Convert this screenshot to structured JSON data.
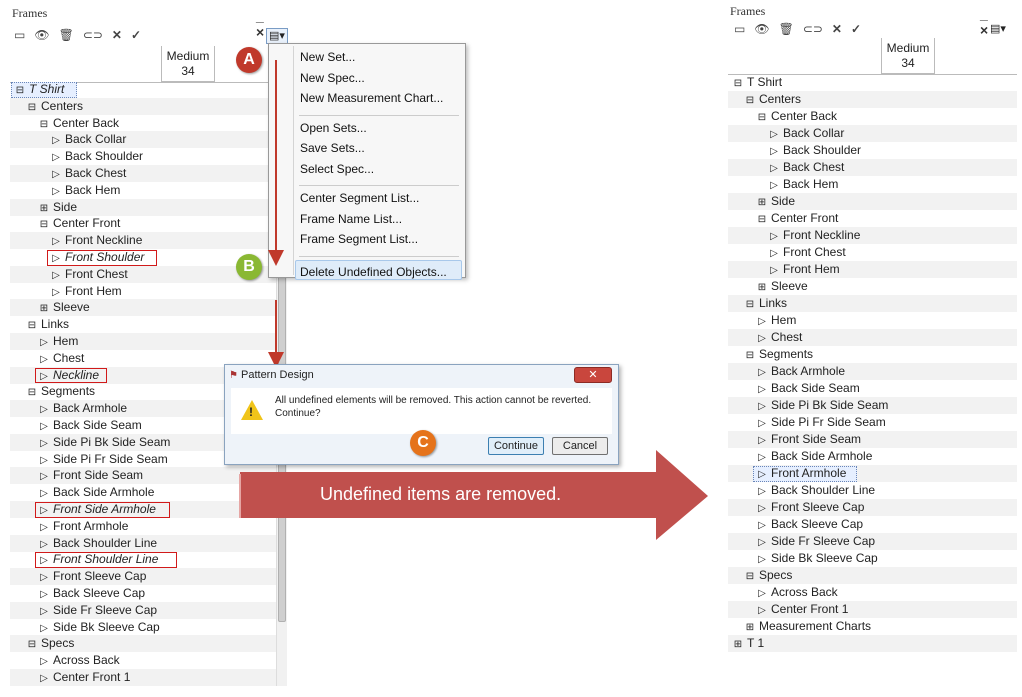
{
  "left_panel": {
    "title": "Frames",
    "window_controls": "_ ×",
    "toolbar_icons": [
      "list-icon",
      "eye-icon",
      "trash-icon",
      "link-icon",
      "x-icon",
      "check-icon"
    ],
    "menu_button_icon": "menu-icon",
    "size_column": {
      "line1": "Medium",
      "line2": "34"
    },
    "tree": [
      {
        "t": "T Shirt",
        "lvl": 0,
        "icon": "⊟",
        "italic": true,
        "box": "sel"
      },
      {
        "t": "Centers",
        "lvl": 1,
        "icon": "⊟"
      },
      {
        "t": "Center Back",
        "lvl": 2,
        "icon": "⊟"
      },
      {
        "t": "Back Collar",
        "lvl": 3,
        "icon": "▷"
      },
      {
        "t": "Back Shoulder",
        "lvl": 3,
        "icon": "▷"
      },
      {
        "t": "Back Chest",
        "lvl": 3,
        "icon": "▷"
      },
      {
        "t": "Back Hem",
        "lvl": 3,
        "icon": "▷"
      },
      {
        "t": "Side",
        "lvl": 2,
        "icon": "⊞"
      },
      {
        "t": "Center Front",
        "lvl": 2,
        "icon": "⊟"
      },
      {
        "t": "Front Neckline",
        "lvl": 3,
        "icon": "▷"
      },
      {
        "t": "Front Shoulder",
        "lvl": 3,
        "icon": "▷",
        "italic": true,
        "box": "red"
      },
      {
        "t": "Front Chest",
        "lvl": 3,
        "icon": "▷"
      },
      {
        "t": "Front Hem",
        "lvl": 3,
        "icon": "▷"
      },
      {
        "t": "Sleeve",
        "lvl": 2,
        "icon": "⊞"
      },
      {
        "t": "Links",
        "lvl": 1,
        "icon": "⊟"
      },
      {
        "t": "Hem",
        "lvl": 2,
        "icon": "▷"
      },
      {
        "t": "Chest",
        "lvl": 2,
        "icon": "▷"
      },
      {
        "t": "Neckline",
        "lvl": 2,
        "icon": "▷",
        "italic": true,
        "box": "red"
      },
      {
        "t": "Segments",
        "lvl": 1,
        "icon": "⊟"
      },
      {
        "t": "Back Armhole",
        "lvl": 2,
        "icon": "▷"
      },
      {
        "t": "Back Side Seam",
        "lvl": 2,
        "icon": "▷"
      },
      {
        "t": "Side Pi Bk Side Seam",
        "lvl": 2,
        "icon": "▷"
      },
      {
        "t": "Side Pi Fr Side Seam",
        "lvl": 2,
        "icon": "▷"
      },
      {
        "t": "Front Side Seam",
        "lvl": 2,
        "icon": "▷"
      },
      {
        "t": "Back Side Armhole",
        "lvl": 2,
        "icon": "▷"
      },
      {
        "t": "Front Side Armhole",
        "lvl": 2,
        "icon": "▷",
        "italic": true,
        "box": "red"
      },
      {
        "t": "Front Armhole",
        "lvl": 2,
        "icon": "▷"
      },
      {
        "t": "Back Shoulder Line",
        "lvl": 2,
        "icon": "▷"
      },
      {
        "t": "Front Shoulder Line",
        "lvl": 2,
        "icon": "▷",
        "italic": true,
        "box": "red"
      },
      {
        "t": "Front Sleeve Cap",
        "lvl": 2,
        "icon": "▷"
      },
      {
        "t": "Back Sleeve Cap",
        "lvl": 2,
        "icon": "▷"
      },
      {
        "t": "Side Fr Sleeve Cap",
        "lvl": 2,
        "icon": "▷"
      },
      {
        "t": "Side Bk Sleeve Cap",
        "lvl": 2,
        "icon": "▷"
      },
      {
        "t": "Specs",
        "lvl": 1,
        "icon": "⊟"
      },
      {
        "t": "Across Back",
        "lvl": 2,
        "icon": "▷"
      },
      {
        "t": "Center Front 1",
        "lvl": 2,
        "icon": "▷"
      }
    ]
  },
  "context_menu": {
    "items": [
      {
        "label": "New Set..."
      },
      {
        "label": "New Spec..."
      },
      {
        "label": "New Measurement Chart..."
      },
      {
        "sep": true
      },
      {
        "label": "Open Sets..."
      },
      {
        "label": "Save Sets..."
      },
      {
        "label": "Select Spec..."
      },
      {
        "sep": true
      },
      {
        "label": "Center Segment List..."
      },
      {
        "label": "Frame Name List..."
      },
      {
        "label": "Frame Segment List..."
      },
      {
        "sep": true
      },
      {
        "label": "Delete Undefined Objects...",
        "highlight": true
      }
    ]
  },
  "badges": {
    "a": "A",
    "b": "B",
    "c": "C",
    "color_a": "#c0392b",
    "color_b": "#8ab833",
    "color_c": "#e5731b"
  },
  "dialog": {
    "title": "Pattern Design",
    "close_label": "✕",
    "message_line1": "All undefined elements will be removed. This action cannot be reverted.",
    "message_line2": "Continue?",
    "continue_label": "Continue",
    "cancel_label": "Cancel"
  },
  "banner": {
    "text": "Undefined items are removed.",
    "color": "#c0504d"
  },
  "right_panel": {
    "title": "Frames",
    "window_controls": "_ ×",
    "size_column": {
      "line1": "Medium",
      "line2": "34"
    },
    "tree": [
      {
        "t": "T Shirt",
        "lvl": 0,
        "icon": "⊟"
      },
      {
        "t": "Centers",
        "lvl": 1,
        "icon": "⊟"
      },
      {
        "t": "Center Back",
        "lvl": 2,
        "icon": "⊟"
      },
      {
        "t": "Back Collar",
        "lvl": 3,
        "icon": "▷"
      },
      {
        "t": "Back Shoulder",
        "lvl": 3,
        "icon": "▷"
      },
      {
        "t": "Back Chest",
        "lvl": 3,
        "icon": "▷"
      },
      {
        "t": "Back Hem",
        "lvl": 3,
        "icon": "▷"
      },
      {
        "t": "Side",
        "lvl": 2,
        "icon": "⊞"
      },
      {
        "t": "Center Front",
        "lvl": 2,
        "icon": "⊟"
      },
      {
        "t": "Front Neckline",
        "lvl": 3,
        "icon": "▷"
      },
      {
        "t": "Front Chest",
        "lvl": 3,
        "icon": "▷"
      },
      {
        "t": "Front Hem",
        "lvl": 3,
        "icon": "▷"
      },
      {
        "t": "Sleeve",
        "lvl": 2,
        "icon": "⊞"
      },
      {
        "t": "Links",
        "lvl": 1,
        "icon": "⊟"
      },
      {
        "t": "Hem",
        "lvl": 2,
        "icon": "▷"
      },
      {
        "t": "Chest",
        "lvl": 2,
        "icon": "▷"
      },
      {
        "t": "Segments",
        "lvl": 1,
        "icon": "⊟"
      },
      {
        "t": "Back Armhole",
        "lvl": 2,
        "icon": "▷"
      },
      {
        "t": "Back Side Seam",
        "lvl": 2,
        "icon": "▷"
      },
      {
        "t": "Side Pi Bk Side Seam",
        "lvl": 2,
        "icon": "▷"
      },
      {
        "t": "Side Pi Fr Side Seam",
        "lvl": 2,
        "icon": "▷"
      },
      {
        "t": "Front Side Seam",
        "lvl": 2,
        "icon": "▷"
      },
      {
        "t": "Back Side Armhole",
        "lvl": 2,
        "icon": "▷"
      },
      {
        "t": "Front Armhole",
        "lvl": 2,
        "icon": "▷",
        "box": "sel"
      },
      {
        "t": "Back Shoulder Line",
        "lvl": 2,
        "icon": "▷"
      },
      {
        "t": "Front Sleeve Cap",
        "lvl": 2,
        "icon": "▷"
      },
      {
        "t": "Back Sleeve Cap",
        "lvl": 2,
        "icon": "▷"
      },
      {
        "t": "Side Fr Sleeve Cap",
        "lvl": 2,
        "icon": "▷"
      },
      {
        "t": "Side Bk Sleeve Cap",
        "lvl": 2,
        "icon": "▷"
      },
      {
        "t": "Specs",
        "lvl": 1,
        "icon": "⊟"
      },
      {
        "t": "Across Back",
        "lvl": 2,
        "icon": "▷"
      },
      {
        "t": "Center Front 1",
        "lvl": 2,
        "icon": "▷"
      },
      {
        "t": "Measurement Charts",
        "lvl": 1,
        "icon": "⊞"
      },
      {
        "t": "T 1",
        "lvl": 0,
        "icon": "⊞"
      }
    ]
  }
}
